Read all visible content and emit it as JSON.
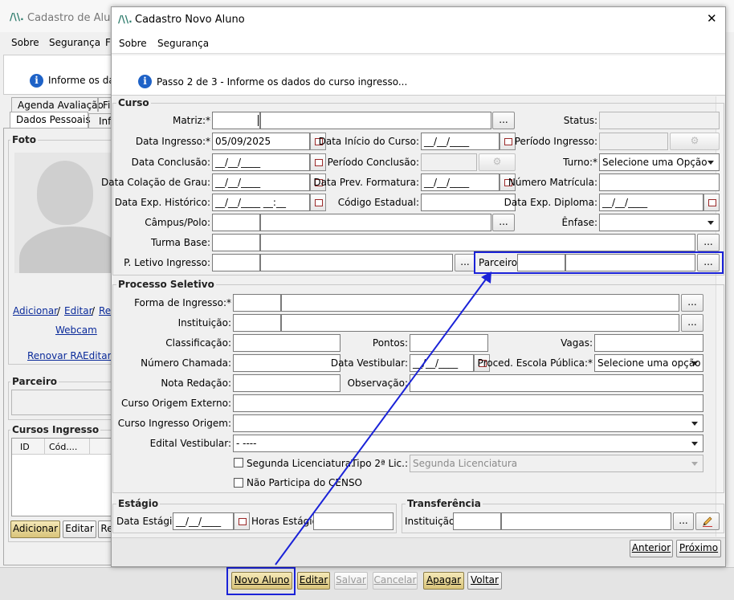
{
  "bg_window": {
    "title": "Cadastro de Aluno",
    "menu": [
      "Sobre",
      "Segurança",
      "F"
    ],
    "info_text": "Informe os dad",
    "tabs_row1": [
      "Agenda Avaliação",
      "Fi"
    ],
    "tabs_row2": [
      "Dados Pessoais",
      "Inf"
    ],
    "foto_group": "Foto",
    "photo_links": {
      "adicionar": "Adicionar",
      "sep1": "/",
      "editar": "Editar",
      "sep2": "/",
      "re": "Re",
      "webcam": "Webcam",
      "renovar": "Renovar RA",
      "editar2": "Editar I"
    },
    "parceiro_group": "Parceiro",
    "cursos_group": "Cursos Ingresso",
    "cursos_columns": [
      "ID",
      "Cód...."
    ],
    "bottom_buttons": [
      "Adicionar",
      "Editar",
      "Re"
    ],
    "footer_buttons": {
      "novo": "Novo Aluno",
      "editar": "Editar",
      "salvar": "Salvar",
      "cancelar": "Cancelar",
      "apagar": "Apagar",
      "voltar": "Voltar"
    }
  },
  "dialog": {
    "title": "Cadastro Novo Aluno",
    "close": "✕",
    "menu": [
      "Sobre",
      "Segurança"
    ],
    "step": "Passo 2 de 3 - Informe os dados do curso ingresso...",
    "curso": {
      "group": "Curso",
      "matriz": "Matriz:*",
      "status": "Status:",
      "data_ingresso": "Data Ingresso:*",
      "data_ingresso_value": "05/09/2025",
      "data_inicio_curso": "Data Início do Curso:",
      "data_inicio_value": "__/__/____",
      "periodo_ingresso": "Período Ingresso:",
      "data_conclusao": "Data Conclusão:",
      "data_conclusao_value": "__/__/____",
      "periodo_conclusao": "Período Conclusão:",
      "turno": "Turno:*",
      "turno_value": "Selecione uma Opção",
      "data_colacao": "Data Colação de Grau:",
      "data_colacao_value": "__/__/____",
      "data_prev_formatura": "Data Prev. Formatura:",
      "data_prev_value": "__/__/____",
      "numero_matricula": "Número Matrícula:",
      "data_exp_historico": "Data Exp. Histórico:",
      "data_exp_historico_value": "__/__/____ __:__",
      "codigo_estadual": "Código Estadual:",
      "data_exp_diploma": "Data Exp. Diploma:",
      "data_exp_diploma_value": "__/__/____",
      "campus": "Câmpus/Polo:",
      "enfase": "Ênfase:",
      "turma_base": "Turma Base:",
      "p_letivo": "P. Letivo Ingresso:",
      "parceiro": "Parceiro:",
      "ellipsis": "..."
    },
    "processo": {
      "group": "Processo Seletivo",
      "forma_ingresso": "Forma de Ingresso:*",
      "instituicao": "Instituição:",
      "classificacao": "Classificação:",
      "pontos": "Pontos:",
      "vagas": "Vagas:",
      "numero_chamada": "Número Chamada:",
      "data_vestibular": "Data Vestibular:",
      "data_vestibular_value": "__/__/____",
      "proced_escola": "Proced. Escola Pública:*",
      "proced_value": "Selecione uma opção",
      "nota_redacao": "Nota Redação:",
      "observacao": "Observação:",
      "curso_origem_externo": "Curso Origem Externo:",
      "curso_ingresso_origem": "Curso Ingresso Origem:",
      "edital_vestibular": "Edital Vestibular:",
      "edital_value": "- ----",
      "segunda_lic": "Segunda Licenciatura.",
      "tipo_2_lic": "Tipo 2ª Lic.:",
      "tipo_2_lic_value": "Segunda Licenciatura",
      "nao_participa": "Não Participa do CENSO"
    },
    "estagio": {
      "group": "Estágio",
      "data_estagio": "Data Estágio:",
      "data_estagio_value": "__/__/____",
      "horas_estagio": "Horas Estágio:"
    },
    "transferencia": {
      "group": "Transferência",
      "instituicao": "Instituição:"
    },
    "nav": {
      "anterior": "Anterior",
      "proximo": "Próximo"
    }
  },
  "colors": {
    "highlight": "#1a22d8",
    "arrow": "#1a22d8",
    "link": "#0a2a9a",
    "info": "#1e62c7"
  }
}
